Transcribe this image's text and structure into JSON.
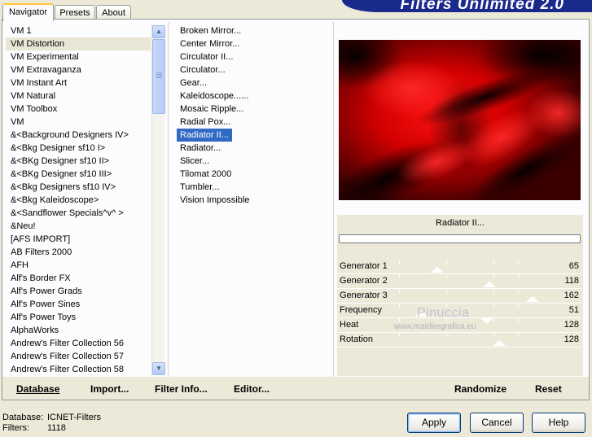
{
  "app": {
    "banner_title": "Filters Unlimited 2.0"
  },
  "tabs": [
    {
      "label": "Navigator",
      "active": true
    },
    {
      "label": "Presets",
      "active": false
    },
    {
      "label": "About",
      "active": false
    }
  ],
  "categories": {
    "selected": "VM Distortion",
    "items": [
      "VM 1",
      "VM Distortion",
      "VM Experimental",
      "VM Extravaganza",
      "VM Instant Art",
      "VM Natural",
      "VM Toolbox",
      "VM",
      "&<Background Designers IV>",
      "&<Bkg Designer sf10 I>",
      "&<BKg Designer sf10 II>",
      "&<BKg Designer sf10 III>",
      "&<Bkg Designers sf10 IV>",
      "&<Bkg Kaleidoscope>",
      "&<Sandflower Specials^v^ >",
      "&Neu!",
      "[AFS IMPORT]",
      "AB Filters 2000",
      "AFH",
      "Alf's Border FX",
      "Alf's Power Grads",
      "Alf's Power Sines",
      "Alf's Power Toys",
      "AlphaWorks",
      "Andrew's Filter Collection 56",
      "Andrew's Filter Collection 57",
      "Andrew's Filter Collection 58"
    ]
  },
  "scrollbar": {
    "up_icon": "▲",
    "down_icon": "▼"
  },
  "filters": {
    "selected": "Radiator II...",
    "items": [
      "Broken Mirror...",
      "Center Mirror...",
      "Circulator II...",
      "Circulator...",
      "Gear...",
      "Kaleidoscope......",
      "Mosaic Ripple...",
      "Radial Pox...",
      "Radiator II...",
      "Radiator...",
      "Slicer...",
      "Tilomat 2000",
      "Tumbler...",
      "Vision Impossible"
    ]
  },
  "preview": {
    "filter_name": "Radiator II..."
  },
  "parameters": [
    {
      "label": "Generator 1",
      "value": "65"
    },
    {
      "label": "Generator 2",
      "value": "118"
    },
    {
      "label": "Generator 3",
      "value": "162"
    },
    {
      "label": "Frequency",
      "value": "51"
    },
    {
      "label": "Heat",
      "value": "128"
    },
    {
      "label": "Rotation",
      "value": "128"
    }
  ],
  "watermark": {
    "name": "Pinuccia",
    "url": "www.maidiregrafica.eu"
  },
  "toolbar": {
    "database": "Database",
    "import": "Import...",
    "filter_info": "Filter Info...",
    "editor": "Editor...",
    "randomize": "Randomize",
    "reset": "Reset"
  },
  "status": {
    "database_label": "Database:",
    "database_value": "ICNET-Filters",
    "filters_label": "Filters:",
    "filters_value": "1118"
  },
  "buttons": {
    "apply": "Apply",
    "cancel": "Cancel",
    "help": "Help"
  }
}
